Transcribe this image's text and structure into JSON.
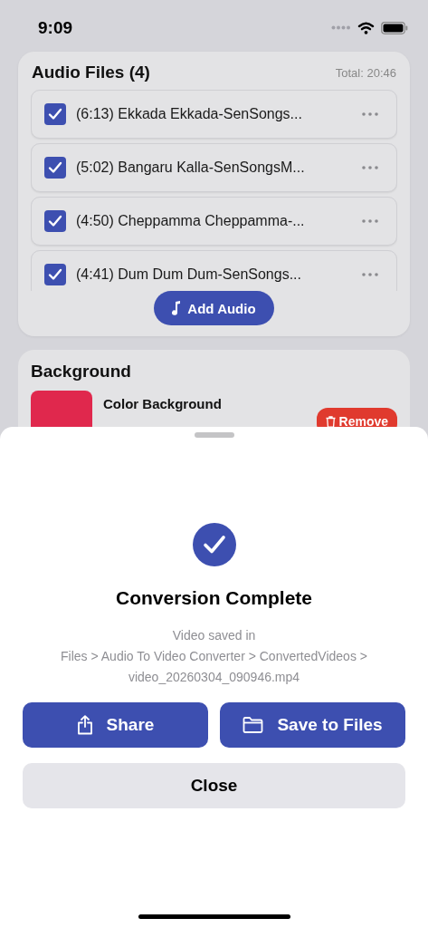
{
  "status_bar": {
    "time": "9:09"
  },
  "audio_files": {
    "title": "Audio Files (4)",
    "total": "Total: 20:46",
    "items": [
      {
        "label": "(6:13) Ekkada Ekkada-SenSongs...",
        "checked": true
      },
      {
        "label": "(5:02) Bangaru Kalla-SenSongsM...",
        "checked": true
      },
      {
        "label": "(4:50) Cheppamma Cheppamma-...",
        "checked": true
      },
      {
        "label": "(4:41) Dum Dum Dum-SenSongs...",
        "checked": true
      }
    ],
    "add_button": "Add Audio"
  },
  "background": {
    "title": "Background",
    "option_title": "Color Background",
    "remove_button": "Remove"
  },
  "sheet": {
    "title": "Conversion Complete",
    "message_lines": [
      "Video saved in",
      "Files > Audio To Video Converter > ConvertedVideos >",
      "video_20260304_090946.mp4"
    ],
    "actions": [
      {
        "label": "Share",
        "kind": "share"
      },
      {
        "label": "Save to Files",
        "kind": "save"
      }
    ],
    "close_button": "Close"
  }
}
